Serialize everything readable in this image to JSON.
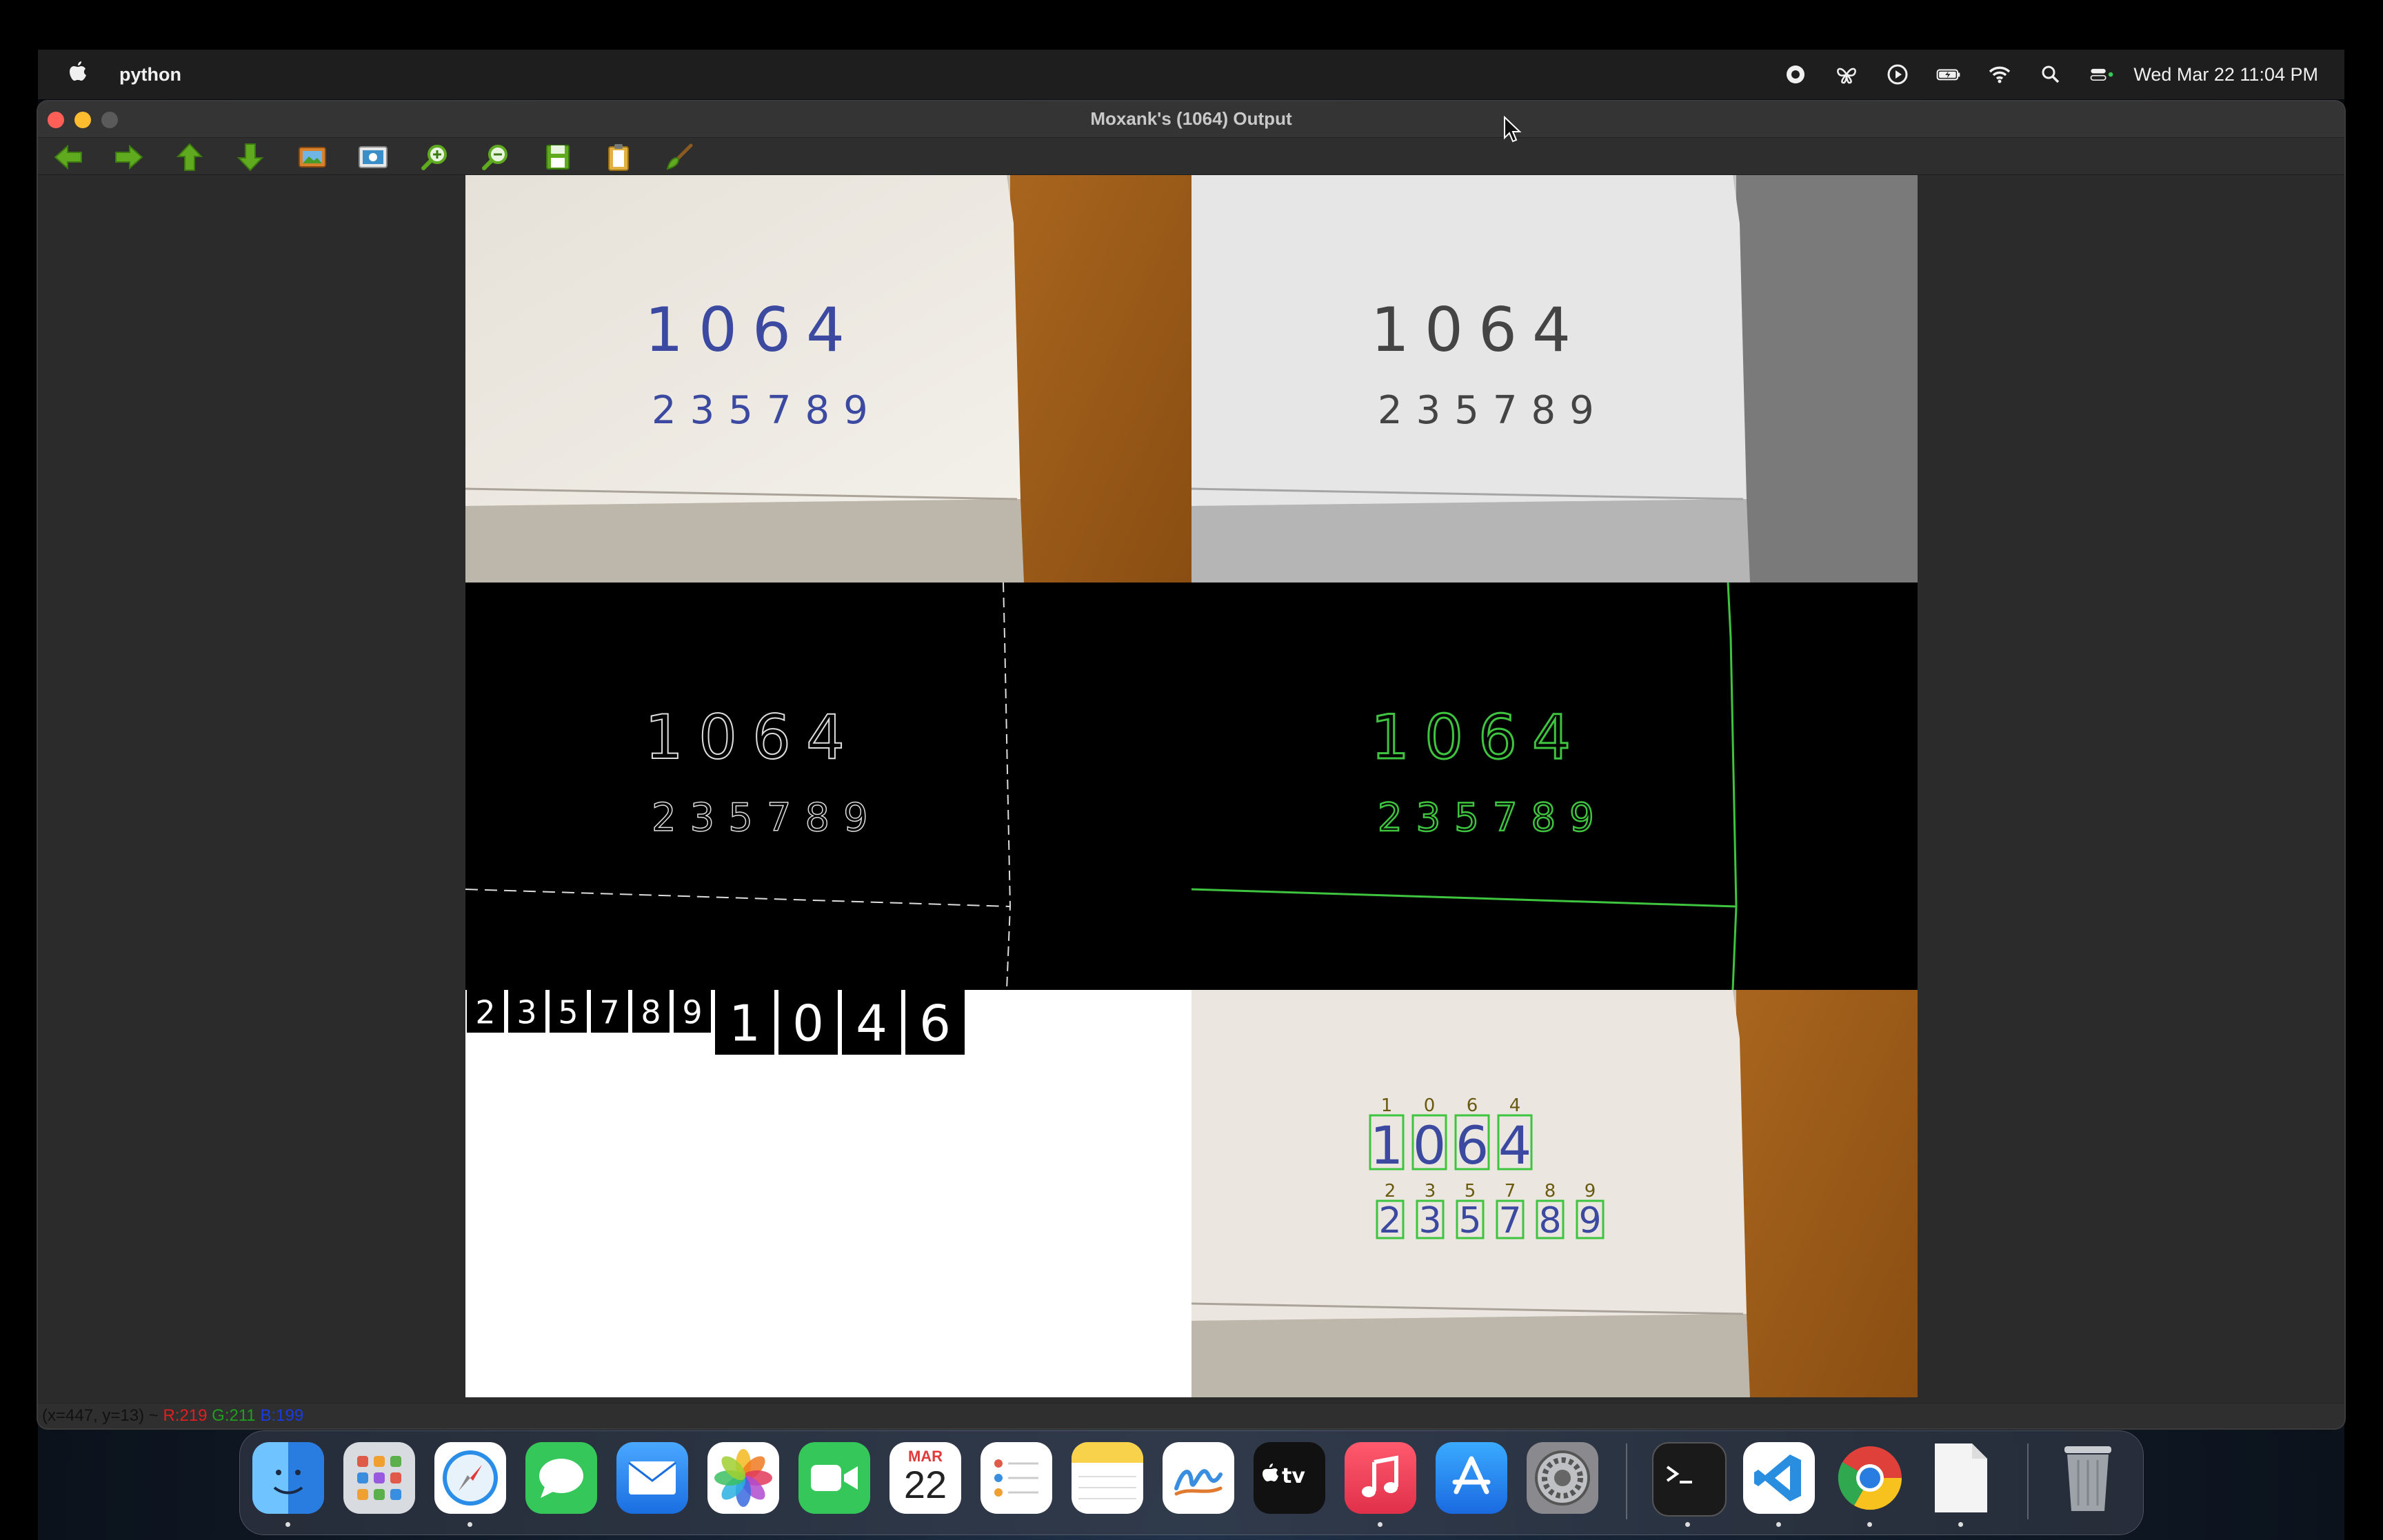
{
  "menubar": {
    "apple_icon": "apple-icon",
    "app_name": "python",
    "clock": "Wed Mar 22  11:04 PM",
    "status_icons": [
      "record-icon",
      "butterfly-icon",
      "play-circle-icon",
      "battery-icon",
      "wifi-icon",
      "search-icon",
      "control-center-icon"
    ]
  },
  "window": {
    "title": "Moxank's (1064) Output",
    "toolbar": [
      "back-arrow-icon",
      "forward-arrow-icon",
      "up-arrow-icon",
      "down-arrow-icon",
      "image-icon",
      "screenshot-icon",
      "zoom-in-icon",
      "zoom-out-icon",
      "save-icon",
      "clipboard-icon",
      "brush-icon"
    ],
    "panels": {
      "top_digits": "1064",
      "bottom_digits": "235789",
      "strip_digits": [
        "2",
        "3",
        "5",
        "7",
        "8",
        "9",
        "1",
        "0",
        "4",
        "6"
      ],
      "labels_top": [
        "1",
        "0",
        "6",
        "4"
      ],
      "labels_bottom": [
        "2",
        "3",
        "5",
        "7",
        "8",
        "9"
      ]
    },
    "status": {
      "coords": "(x=447, y=13) ~ ",
      "r": "R:219",
      "g": "G:211",
      "b": "B:199"
    }
  },
  "dock": {
    "calendar_month": "MAR",
    "calendar_day": "22",
    "apps": [
      "finder",
      "launchpad",
      "safari",
      "messages",
      "mail",
      "photos",
      "facetime",
      "calendar",
      "reminders",
      "notes",
      "freeform",
      "apple-tv",
      "music",
      "app-store",
      "system-settings",
      "terminal",
      "vscode",
      "chrome",
      "document",
      "trash"
    ]
  },
  "colors": {
    "ink_blue": "#3b4aa0",
    "contour_green": "#3ec43e",
    "cardboard": "#a8651e",
    "paper": "#e9e5de"
  }
}
